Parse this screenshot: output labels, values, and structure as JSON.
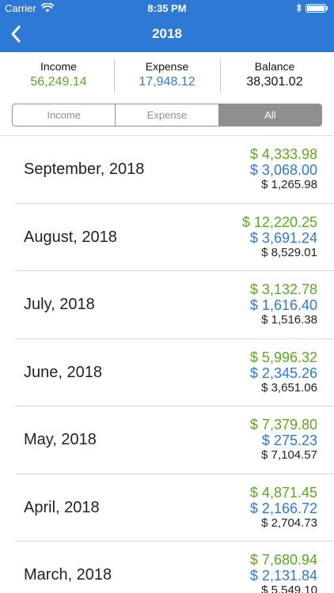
{
  "status_bar": {
    "carrier": "Carrier",
    "time": "8:35 PM",
    "battery_level": 1.0
  },
  "nav": {
    "title": "2018",
    "back_icon": "chevron-left-icon"
  },
  "summary": {
    "income": {
      "label": "Income",
      "value": "56,249.14"
    },
    "expense": {
      "label": "Expense",
      "value": "17,948.12"
    },
    "balance": {
      "label": "Balance",
      "value": "38,301.02"
    }
  },
  "segments": {
    "items": [
      "Income",
      "Expense",
      "All"
    ],
    "selected": "All"
  },
  "colors": {
    "header": "#2f79d6",
    "income": "#5aab1e",
    "expense": "#2f79d6",
    "segment_active": "#8e8e93"
  },
  "months": [
    {
      "name": "September, 2018",
      "income": "$ 4,333.98",
      "expense": "$ 3,068.00",
      "balance": "$ 1,265.98"
    },
    {
      "name": "August, 2018",
      "income": "$ 12,220.25",
      "expense": "$ 3,691.24",
      "balance": "$ 8,529.01"
    },
    {
      "name": "July, 2018",
      "income": "$ 3,132.78",
      "expense": "$ 1,616.40",
      "balance": "$ 1,516.38"
    },
    {
      "name": "June, 2018",
      "income": "$ 5,996.32",
      "expense": "$ 2,345.26",
      "balance": "$ 3,651.06"
    },
    {
      "name": "May, 2018",
      "income": "$ 7,379.80",
      "expense": "$ 275.23",
      "balance": "$ 7,104.57"
    },
    {
      "name": "April, 2018",
      "income": "$ 4,871.45",
      "expense": "$ 2,166.72",
      "balance": "$ 2,704.73"
    },
    {
      "name": "March, 2018",
      "income": "$ 7,680.94",
      "expense": "$ 2,131.84",
      "balance": "$ 5,549.10"
    }
  ]
}
